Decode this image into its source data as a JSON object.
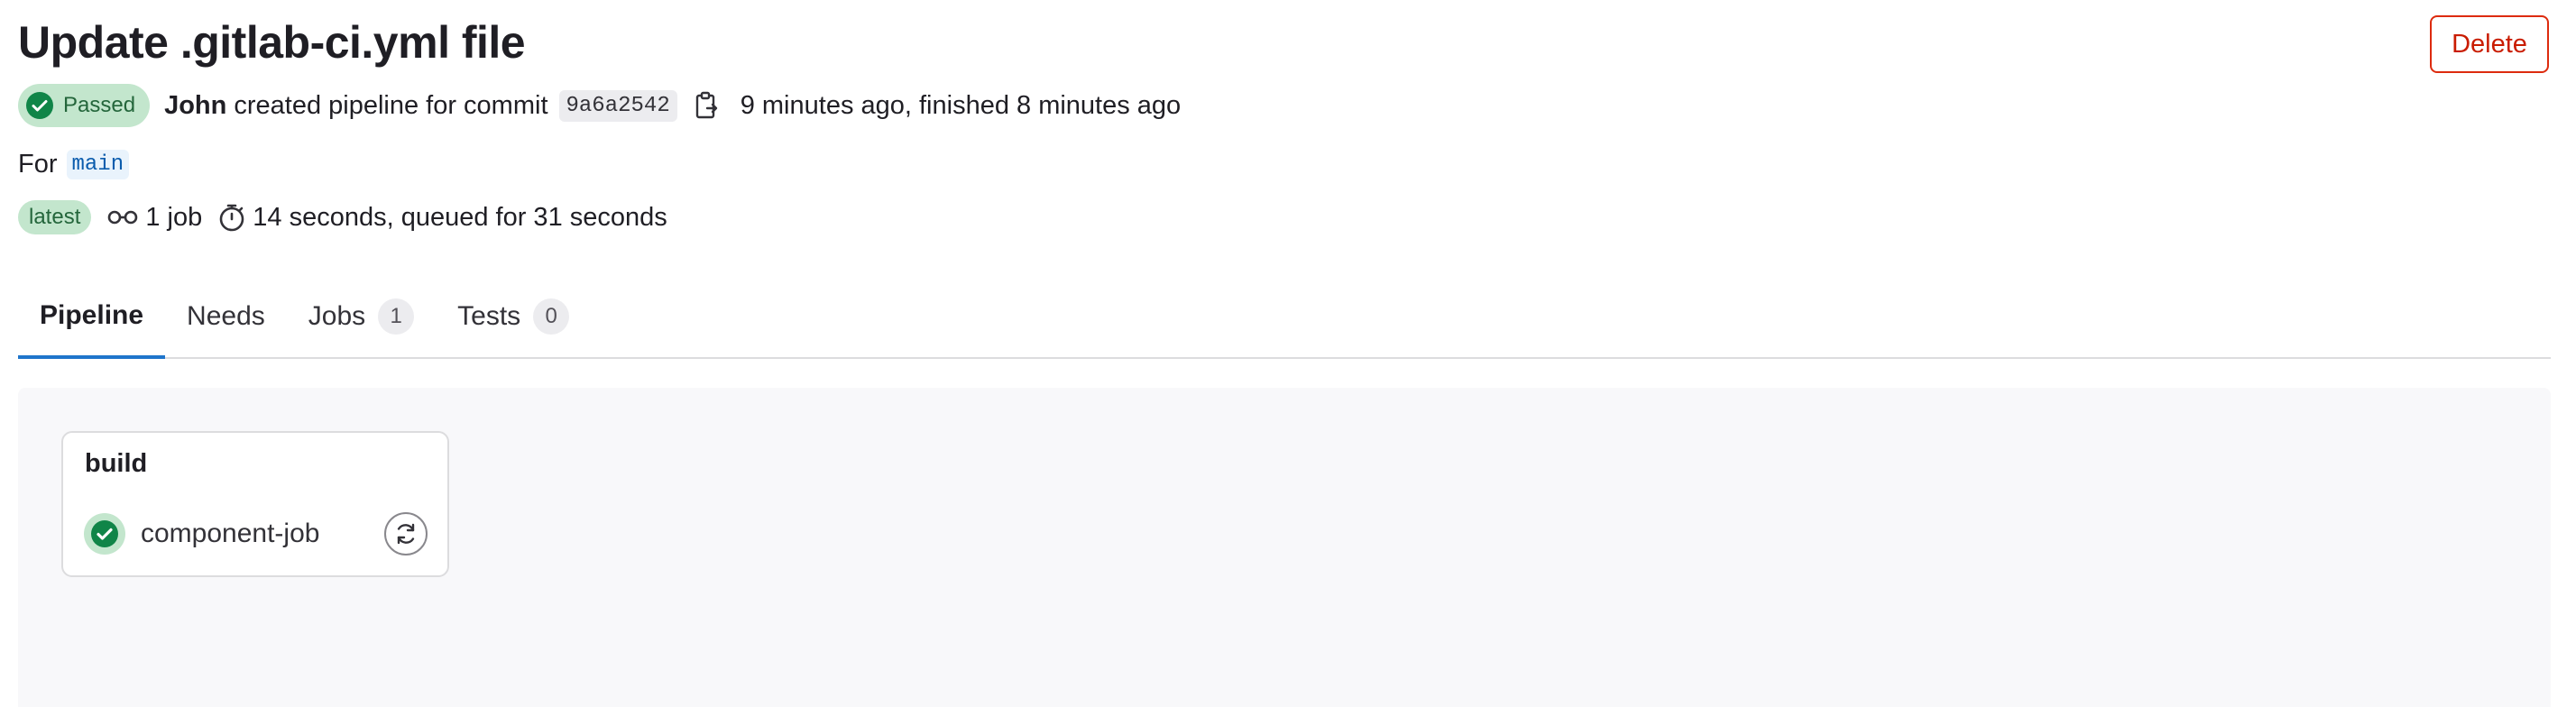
{
  "header": {
    "title": "Update .gitlab-ci.yml file",
    "delete_label": "Delete"
  },
  "pipeline": {
    "status_label": "Passed",
    "author": "John",
    "created_text": "created pipeline for commit",
    "commit_sha": "9a6a2542",
    "timing_text": "9 minutes ago, finished 8 minutes ago",
    "for_label": "For",
    "branch": "main",
    "latest_label": "latest",
    "jobs_count_text": "1 job",
    "duration_text": "14 seconds, queued for 31 seconds"
  },
  "tabs": [
    {
      "label": "Pipeline",
      "count": null,
      "active": true
    },
    {
      "label": "Needs",
      "count": null,
      "active": false
    },
    {
      "label": "Jobs",
      "count": "1",
      "active": false
    },
    {
      "label": "Tests",
      "count": "0",
      "active": false
    }
  ],
  "graph": {
    "stages": [
      {
        "name": "build",
        "jobs": [
          {
            "name": "component-job",
            "status": "success"
          }
        ]
      }
    ]
  },
  "colors": {
    "success": "#108548",
    "success_bg": "#c3e6cd",
    "danger": "#dd2b0e",
    "tab_active": "#1f75cb",
    "branch_link": "#0b5cad"
  },
  "icons": {
    "status": "check-circle-icon",
    "copy": "copy-to-clipboard-icon",
    "jobs": "pipeline-jobs-icon",
    "duration": "timer-icon",
    "retry": "retry-icon"
  }
}
